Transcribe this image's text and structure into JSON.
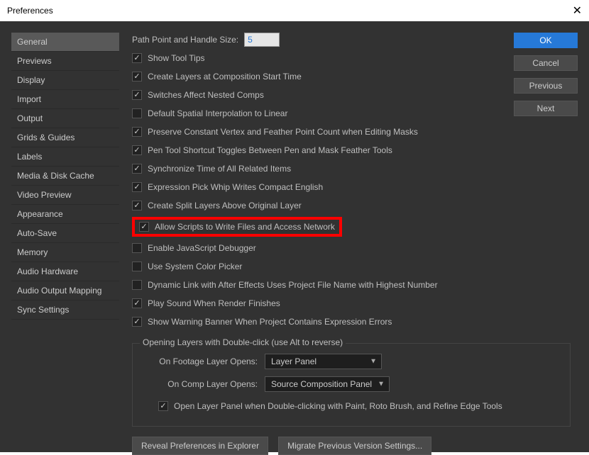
{
  "window": {
    "title": "Preferences"
  },
  "sidebar": {
    "items": [
      "General",
      "Previews",
      "Display",
      "Import",
      "Output",
      "Grids & Guides",
      "Labels",
      "Media & Disk Cache",
      "Video Preview",
      "Appearance",
      "Auto-Save",
      "Memory",
      "Audio Hardware",
      "Audio Output Mapping",
      "Sync Settings"
    ],
    "active_index": 0
  },
  "header": {
    "handle_label": "Path Point and Handle Size:",
    "handle_value": "5"
  },
  "checks": [
    {
      "label": "Show Tool Tips",
      "checked": true
    },
    {
      "label": "Create Layers at Composition Start Time",
      "checked": true
    },
    {
      "label": "Switches Affect Nested Comps",
      "checked": true
    },
    {
      "label": "Default Spatial Interpolation to Linear",
      "checked": false
    },
    {
      "label": "Preserve Constant Vertex and Feather Point Count when Editing Masks",
      "checked": true
    },
    {
      "label": "Pen Tool Shortcut Toggles Between Pen and Mask Feather Tools",
      "checked": true
    },
    {
      "label": "Synchronize Time of All Related Items",
      "checked": true
    },
    {
      "label": "Expression Pick Whip Writes Compact English",
      "checked": true
    },
    {
      "label": "Create Split Layers Above Original Layer",
      "checked": true
    },
    {
      "label": "Allow Scripts to Write Files and Access Network",
      "checked": true,
      "highlight": true
    },
    {
      "label": "Enable JavaScript Debugger",
      "checked": false
    },
    {
      "label": "Use System Color Picker",
      "checked": false
    },
    {
      "label": "Dynamic Link with After Effects Uses Project File Name with Highest Number",
      "checked": false
    },
    {
      "label": "Play Sound When Render Finishes",
      "checked": true
    },
    {
      "label": "Show Warning Banner When Project Contains Expression Errors",
      "checked": true
    }
  ],
  "group": {
    "title": "Opening Layers with Double-click (use Alt to reverse)",
    "footage_label": "On Footage Layer Opens:",
    "footage_value": "Layer Panel",
    "comp_label": "On Comp Layer Opens:",
    "comp_value": "Source Composition Panel",
    "open_layer_panel": {
      "label": "Open Layer Panel when Double-clicking with Paint, Roto Brush, and Refine Edge Tools",
      "checked": true
    }
  },
  "bottom_buttons": {
    "reveal": "Reveal Preferences in Explorer",
    "migrate": "Migrate Previous Version Settings..."
  },
  "right_buttons": {
    "ok": "OK",
    "cancel": "Cancel",
    "previous": "Previous",
    "next": "Next"
  }
}
